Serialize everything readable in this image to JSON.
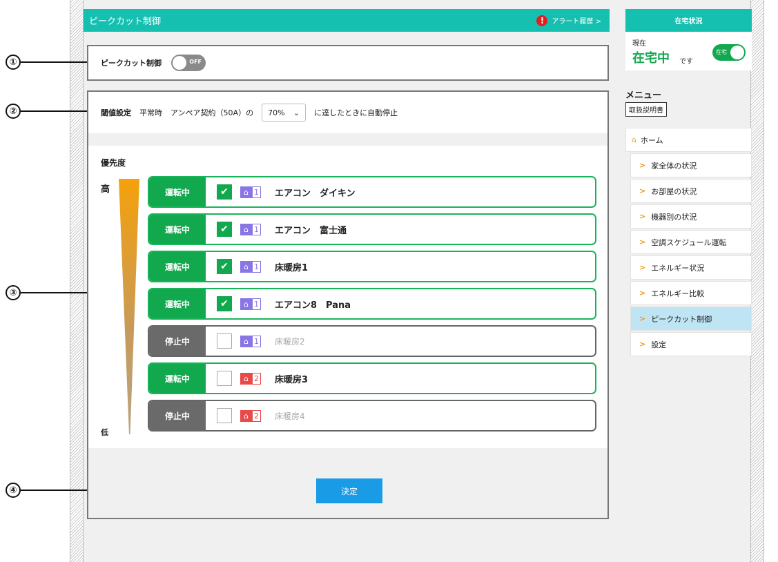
{
  "header": {
    "title": "ピークカット制御",
    "alert_icon": "!",
    "alert_link": "アラート履歴 >"
  },
  "callouts": [
    "①",
    "②",
    "③",
    "④"
  ],
  "peak_cut": {
    "label": "ピークカット制御",
    "toggle": "OFF"
  },
  "threshold": {
    "label": "閾値設定",
    "mode": "平常時",
    "contract": "アンペア契約（50A）の",
    "value": "70%",
    "chevron": "⌄",
    "suffix": "に達したときに自動停止"
  },
  "priority": {
    "title": "優先度",
    "high": "高",
    "low": "低"
  },
  "devices": [
    {
      "status": "運転中",
      "checked": true,
      "floor": "1",
      "name": "エアコン　ダイキン",
      "running": true
    },
    {
      "status": "運転中",
      "checked": true,
      "floor": "1",
      "name": "エアコン　富士通",
      "running": true
    },
    {
      "status": "運転中",
      "checked": true,
      "floor": "1",
      "name": "床暖房1",
      "running": true
    },
    {
      "status": "運転中",
      "checked": true,
      "floor": "1",
      "name": "エアコン8　Pana",
      "running": true
    },
    {
      "status": "停止中",
      "checked": false,
      "floor": "1",
      "name": "床暖房2",
      "running": false
    },
    {
      "status": "運転中",
      "checked": false,
      "floor": "2",
      "name": "床暖房3",
      "running": true
    },
    {
      "status": "停止中",
      "checked": false,
      "floor": "2",
      "name": "床暖房4",
      "running": false
    }
  ],
  "check_mark": "✔",
  "house_glyph": "⌂",
  "submit_label": "決定",
  "sidebar": {
    "status_header": "在宅状況",
    "now_label": "現在",
    "home_value": "在宅中",
    "desu": "です",
    "toggle_label": "在宅",
    "menu_title": "メニュー",
    "manual": "取扱説明書",
    "home_glyph": "⌂",
    "arrow_glyph": ">",
    "items": [
      {
        "label": "ホーム",
        "type": "home"
      },
      {
        "label": "家全体の状況",
        "type": "sub"
      },
      {
        "label": "お部屋の状況",
        "type": "sub"
      },
      {
        "label": "機器別の状況",
        "type": "sub"
      },
      {
        "label": "空調スケジュール運転",
        "type": "sub"
      },
      {
        "label": "エネルギー状況",
        "type": "sub"
      },
      {
        "label": "エネルギー比較",
        "type": "sub"
      },
      {
        "label": "ピークカット制御",
        "type": "sub",
        "active": true
      },
      {
        "label": "設定",
        "type": "sub"
      }
    ]
  },
  "colors": {
    "teal": "#16c0b0",
    "running": "#12a94e",
    "stopped": "#6a6a6a",
    "submit": "#1a9be6",
    "floor1": "#8a75e6",
    "floor2": "#e84a4a",
    "active_menu": "#bfe5f4"
  }
}
